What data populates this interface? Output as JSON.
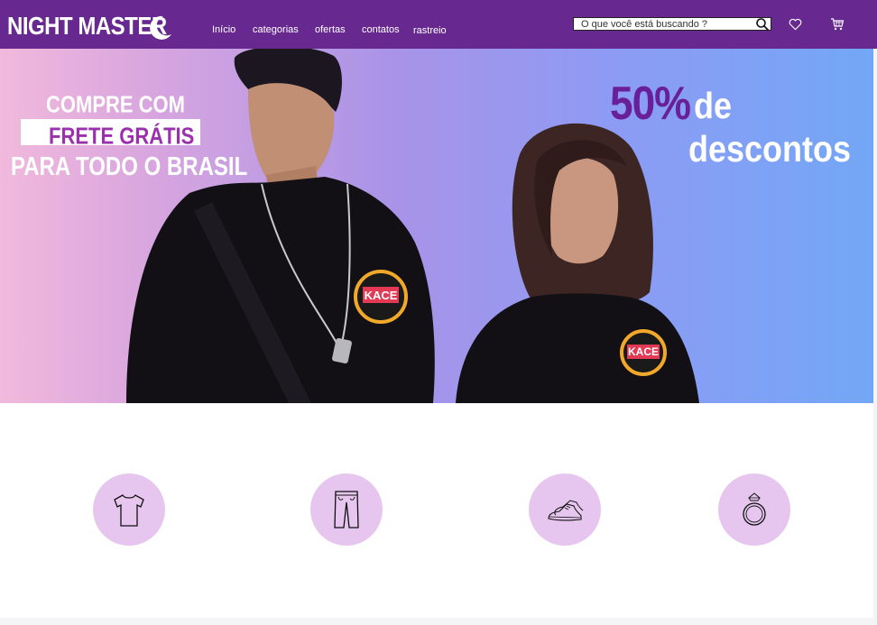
{
  "header": {
    "logo_text": "NIGHT MASTER",
    "nav": [
      "Início",
      "categorias",
      "ofertas",
      "contatos",
      "rastreio"
    ],
    "search": {
      "placeholder": "O que você está buscando ?"
    },
    "icons": [
      "moon-icon",
      "search-icon",
      "heart-icon",
      "cart-icon"
    ],
    "background_color": "#67298f"
  },
  "hero": {
    "left_promo": {
      "line1": "COMPRE COM",
      "line2": "FRETE GRÁTIS",
      "line3": "PARA TODO O BRASIL"
    },
    "right_promo": {
      "percent": "50%",
      "word1": "de",
      "word2": "descontos"
    },
    "shirt_badge_text": "KACE",
    "accent_color": "#6a1f9a"
  },
  "categories": [
    {
      "icon": "tshirt-icon"
    },
    {
      "icon": "pants-icon"
    },
    {
      "icon": "sneakers-icon"
    },
    {
      "icon": "ring-icon"
    }
  ]
}
